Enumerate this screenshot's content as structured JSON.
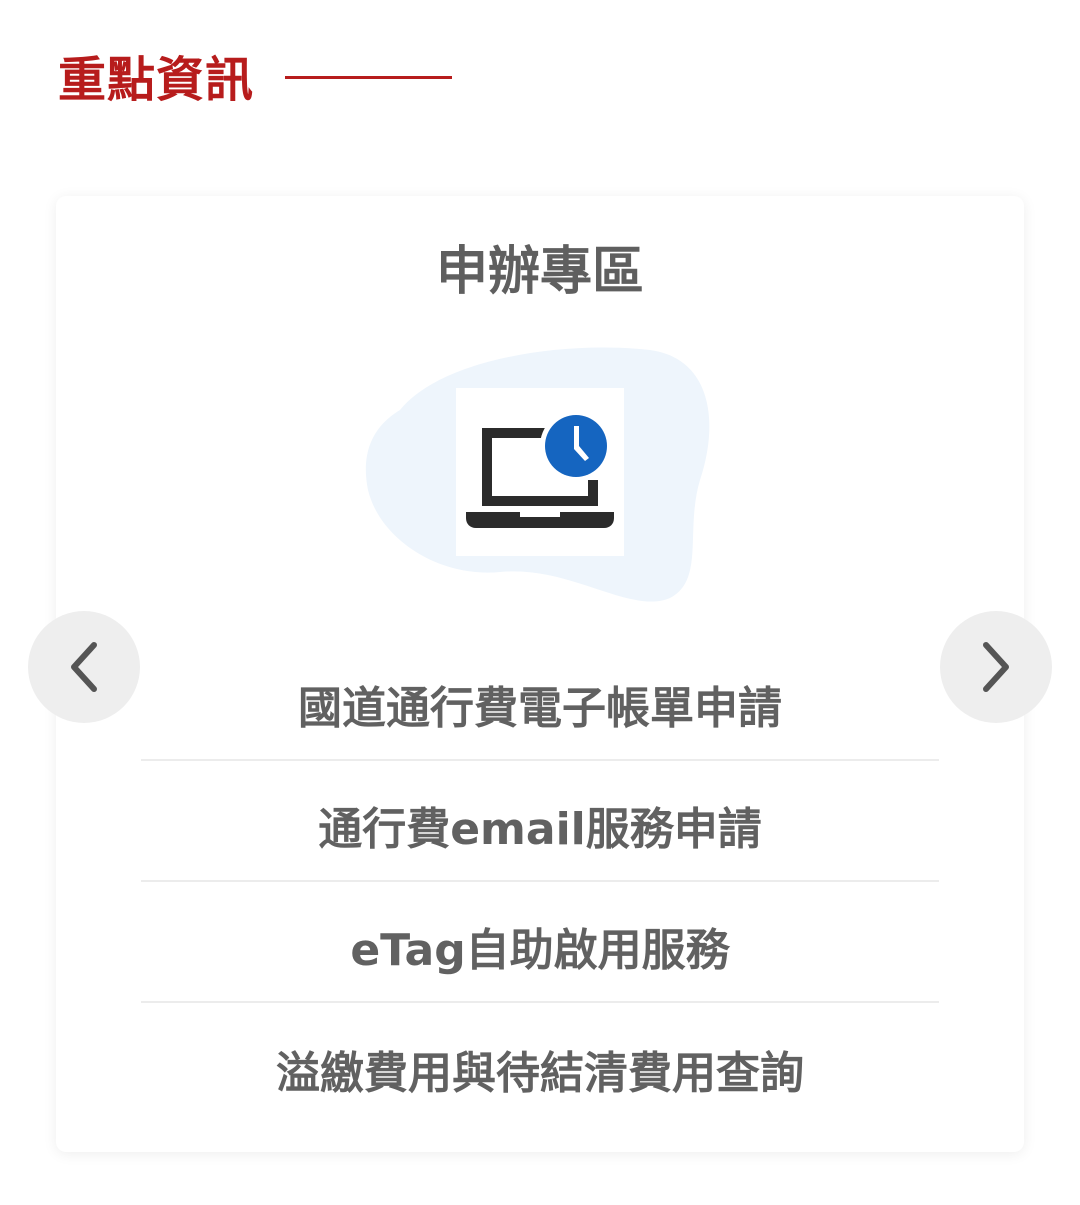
{
  "section": {
    "title": "重點資訊"
  },
  "card": {
    "title": "申辦專區",
    "icon": "laptop-clock-icon",
    "accent_color": "#1565c0",
    "blob_color": "#eef5fc",
    "items": [
      {
        "label": "國道通行費電子帳單申請"
      },
      {
        "label": "通行費email服務申請"
      },
      {
        "label": "eTag自助啟用服務"
      },
      {
        "label": "溢繳費用與待結清費用查詢"
      }
    ]
  },
  "carousel": {
    "prev_icon": "chevron-left-icon",
    "next_icon": "chevron-right-icon"
  },
  "colors": {
    "heading": "#b71c1c",
    "text": "#616161",
    "nav_bg": "#eeeeee"
  }
}
